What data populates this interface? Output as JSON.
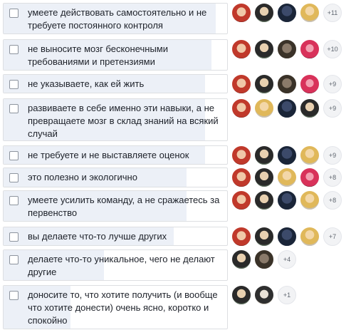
{
  "poll": {
    "options": [
      {
        "label": "умеете действовать самостоятельно и не требуете постоянного контроля",
        "more": "+11",
        "fill": 0.95,
        "avatars": [
          "c1",
          "c2",
          "c3",
          "c4"
        ]
      },
      {
        "label": "не выносите мозг бесконечными требованиями и претензиями",
        "more": "+10",
        "fill": 0.93,
        "avatars": [
          "c1",
          "c2",
          "c6",
          "c5"
        ]
      },
      {
        "label": "не указываете, как ей жить",
        "more": "+9",
        "fill": 0.9,
        "avatars": [
          "c1",
          "c2",
          "c6",
          "c5"
        ]
      },
      {
        "label": "развиваете в себе именно эти навыки, а не превращаете мозг в склад знаний на всякий случай",
        "more": "+9",
        "fill": 0.9,
        "avatars": [
          "c1",
          "c4",
          "c3",
          "c2"
        ]
      },
      {
        "label": "не требуете и не выставляете оценок",
        "more": "+9",
        "fill": 0.9,
        "avatars": [
          "c1",
          "c2",
          "c3",
          "c4"
        ]
      },
      {
        "label": "это полезно и экологично",
        "more": "+8",
        "fill": 0.82,
        "avatars": [
          "c1",
          "c2",
          "c4",
          "c5"
        ]
      },
      {
        "label": "умеете усилить команду, а не сражаетесь за первенство",
        "more": "+8",
        "fill": 0.82,
        "avatars": [
          "c1",
          "c2",
          "c3",
          "c4"
        ]
      },
      {
        "label": "вы делаете что-то лучше других",
        "more": "+7",
        "fill": 0.76,
        "avatars": [
          "c1",
          "c2",
          "c3",
          "c4"
        ]
      },
      {
        "label": "делаете что-то уникальное, чего не делают другие",
        "more": "+4",
        "fill": 0.45,
        "avatars": [
          "c2",
          "c6"
        ]
      },
      {
        "label": "доносите то, что хотите получить (и вообще что хотите донести) очень ясно, коротко и спокойно",
        "more": "+1",
        "fill": 0.3,
        "avatars": [
          "c2",
          "c7"
        ]
      }
    ]
  }
}
